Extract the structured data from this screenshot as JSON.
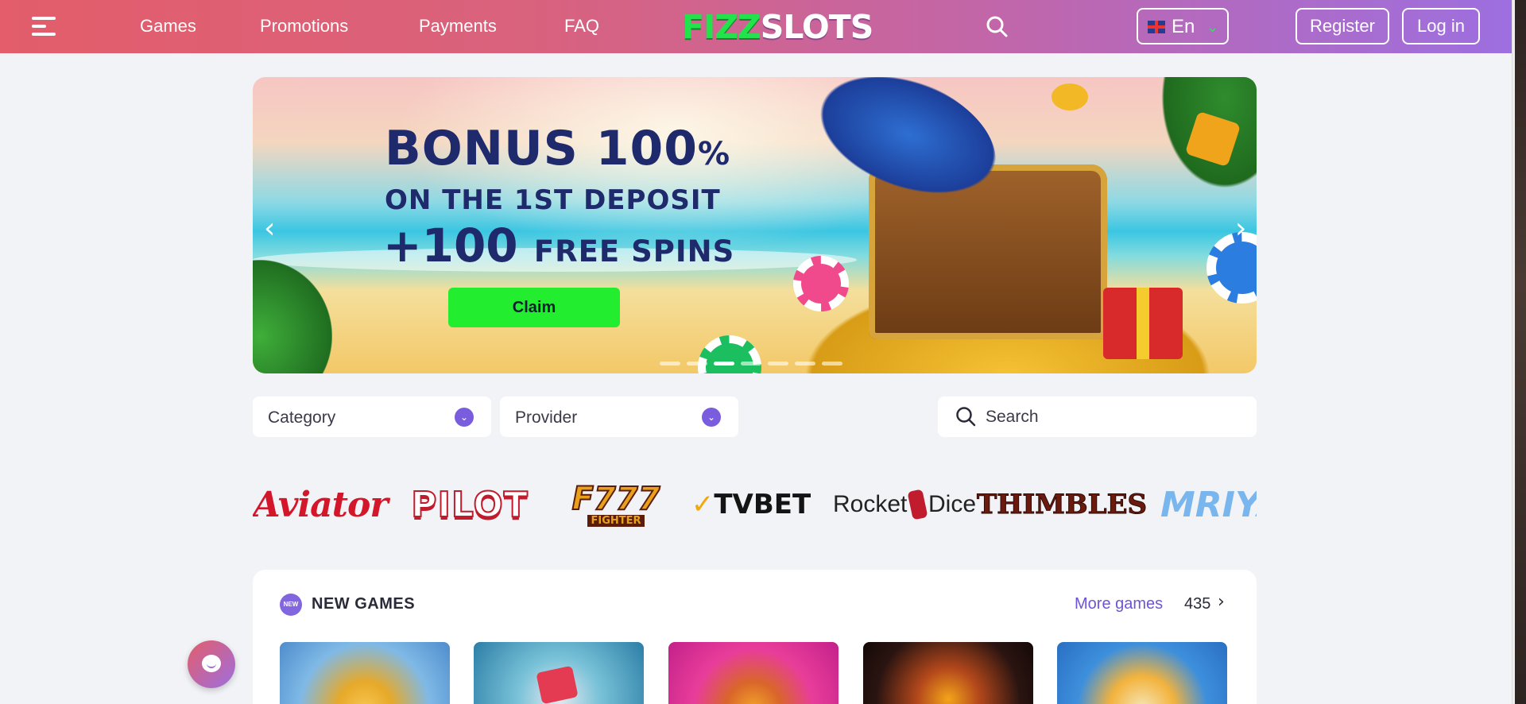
{
  "header": {
    "nav": [
      "Games",
      "Promotions",
      "Payments",
      "FAQ"
    ],
    "logo_fizz": "FIZZ",
    "logo_slots": "SLOTS",
    "language": "En",
    "register_label": "Register",
    "login_label": "Log in"
  },
  "banner": {
    "line1": "BONUS 100",
    "line1_pct": "%",
    "line2": "ON THE 1ST DEPOSIT",
    "line3_big": "+100",
    "line3_small": "FREE SPINS",
    "claim_label": "Claim",
    "slide_count": 7,
    "active_slide": 3
  },
  "filters": {
    "category_label": "Category",
    "provider_label": "Provider",
    "search_placeholder": "Search"
  },
  "providers": {
    "aviator": "Aviator",
    "pilot": "PILOT",
    "f777": "F777",
    "f777_sub": "FIGHTER",
    "tvbet": "TVBET",
    "rocket_dice_left": "Rocket",
    "rocket_dice_right": "Dice",
    "thimbles": "THIMBLES",
    "mriya": "MRIYA"
  },
  "new_games": {
    "badge": "NEW",
    "title": "NEW GAMES",
    "more_label": "More games",
    "more_count": "435"
  },
  "colors": {
    "header_start": "#e35d6a",
    "header_end": "#9d6fe0",
    "accent_purple": "#7a5cde",
    "claim_green": "#22ee2f",
    "page_bg": "#f2f3f7"
  }
}
